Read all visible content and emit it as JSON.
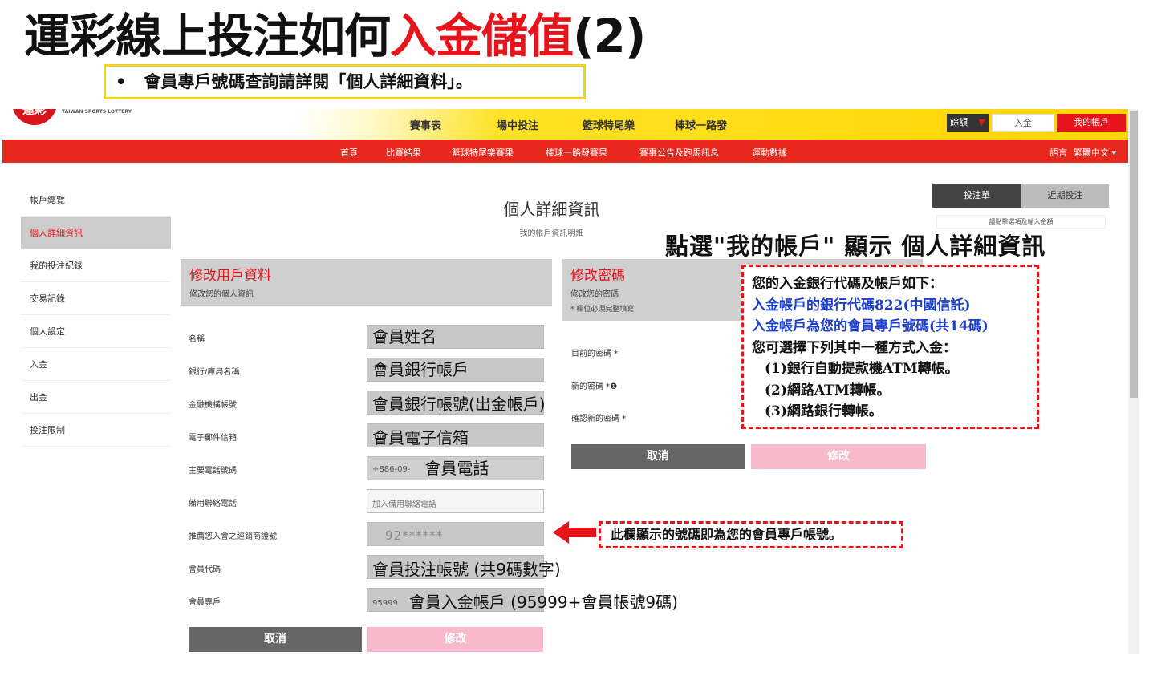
{
  "title": {
    "part1": "運彩線上投注如何",
    "part2": "入金儲值",
    "part3": "(2)"
  },
  "subtitle": {
    "bullet": "•",
    "text": "會員專戶號碼查詢請詳閱「個人詳細資料」。"
  },
  "header": {
    "logo_text": "運彩",
    "logo_caption": "TAIWAN SPORTS LOTTERY",
    "top_nav": [
      "賽事表",
      "場中投注",
      "籃球特尾樂",
      "棒球一路發"
    ],
    "balance_label": "餘額",
    "deposit_label": "入金",
    "my_account_label": "我的帳戶",
    "red_nav": [
      "首頁",
      "比賽結果",
      "籃球特尾樂賽果",
      "棒球一路發賽果",
      "賽事公告及跑馬訊息",
      "運動數據"
    ],
    "language_label": "語言",
    "language_value": "繁體中文"
  },
  "sidebar": {
    "items": [
      {
        "label": "帳戶總覽"
      },
      {
        "label": "個人詳細資訊"
      },
      {
        "label": "我的投注紀錄"
      },
      {
        "label": "交易記錄"
      },
      {
        "label": "個人設定"
      },
      {
        "label": "入金"
      },
      {
        "label": "出金"
      },
      {
        "label": "投注限制"
      }
    ]
  },
  "page_head": {
    "title": "個人詳細資訊",
    "subtitle": "我的帳戶資訊明細"
  },
  "betslip": {
    "tab_slip": "投注單",
    "tab_recent": "近期投注",
    "hint": "請點擊選項及輸入金額"
  },
  "user_panel": {
    "title": "修改用戶資料",
    "subtitle": "修改您的個人資訊",
    "fields": [
      {
        "label": "名稱",
        "value": "會員姓名"
      },
      {
        "label": "銀行/庫局名稱",
        "value": "會員銀行帳戶"
      },
      {
        "label": "金融機構帳號",
        "value": "會員銀行帳號(出金帳戶)"
      },
      {
        "label": "電子郵件信箱",
        "value": "會員電子信箱"
      },
      {
        "label": "主要電話號碼",
        "prefix": "+886-09-",
        "value": "會員電話"
      },
      {
        "label": "備用聯絡電話",
        "placeholder": "加入備用聯絡電話"
      },
      {
        "label": "推薦您入會之經銷商證號",
        "value": "92******"
      },
      {
        "label": "會員代碼",
        "value": "會員投注帳號 (共9碼數字)"
      },
      {
        "label": "會員專戶",
        "prefix": "95999",
        "value": "會員入金帳戶 (95999+會員帳號9碼)"
      }
    ],
    "cancel_label": "取消",
    "modify_label": "修改"
  },
  "pw_panel": {
    "title": "修改密碼",
    "subtitle": "修改您的密碼",
    "required_note": "* 欄位必須完整填寫",
    "current_pw_label": "目前的密碼 *",
    "new_pw_label": "新的密碼 *",
    "confirm_pw_label": "確認新的密碼 *",
    "cancel_label": "取消",
    "modify_label": "修改"
  },
  "annotations": {
    "click_note": "點選\"我的帳戶\" 顯示 個人詳細資訊",
    "box_lines": [
      {
        "text": "您的入金銀行代碼及帳戶如下：",
        "color": "black"
      },
      {
        "text": "入金帳戶的銀行代碼822(中國信託)",
        "color": "blue"
      },
      {
        "text": "入金帳戶為您的會員專戶號碼(共14碼)",
        "color": "blue"
      },
      {
        "text": "您可選擇下列其中一種方式入金：",
        "color": "black"
      },
      {
        "text": "(1)銀行自動提款機ATM轉帳。",
        "color": "black"
      },
      {
        "text": "(2)網路ATM轉帳。",
        "color": "black"
      },
      {
        "text": "(3)網路銀行轉帳。",
        "color": "black"
      }
    ],
    "account_note": "此欄顯示的號碼即為您的會員專戶帳號。"
  },
  "colors": {
    "brand_red": "#e8141c",
    "brand_yellow": "#ffd500",
    "annotation_blue": "#1c3fc9"
  }
}
